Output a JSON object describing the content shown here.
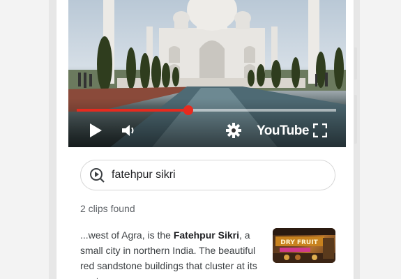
{
  "player": {
    "progress_fraction": 0.43,
    "brand_label": "YouTube",
    "accent_color": "#e82a1e",
    "icons": [
      "play-icon",
      "volume-icon",
      "settings-gear-icon",
      "fullscreen-icon"
    ]
  },
  "search": {
    "query": "fatehpur sikri",
    "icon": "search-clip-icon"
  },
  "results": {
    "count_label": "2 clips found",
    "items": [
      {
        "text_before": "...west of Agra, is the ",
        "highlight": "Fatehpur Sikri",
        "text_after": ", a small city in northern India. The beautiful red sandstone buildings that cluster at its center",
        "thumbnail_text": "DRY FRUIT"
      }
    ]
  }
}
